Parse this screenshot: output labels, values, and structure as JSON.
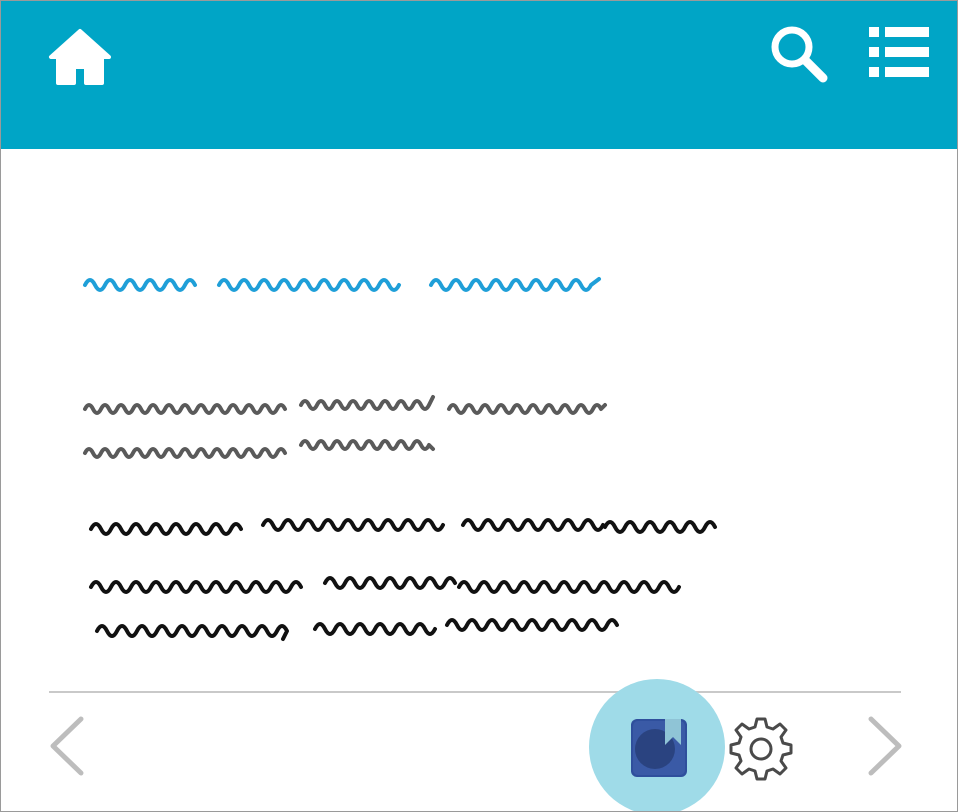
{
  "header": {
    "background_color": "#00a5c6",
    "icon_color": "#ffffff",
    "home_icon": "home-icon",
    "search_icon": "search-icon",
    "menu_icon": "list-menu-icon"
  },
  "content": {
    "title_scribble_color": "#1f9fd8",
    "subtitle_scribble_color": "#5a5a5a",
    "body_scribble_color": "#111111",
    "title_lines": 1,
    "subtitle_lines": 2,
    "body_lines": 3
  },
  "footer": {
    "prev_icon": "chevron-left-icon",
    "next_icon": "chevron-right-icon",
    "bookmark_icon": "book-bookmark-icon",
    "settings_icon": "gear-icon",
    "highlight_color": "#9fdbe8",
    "bookmark_color": "#2f4f9c",
    "arrow_color": "#bdbdbd",
    "gear_color": "#4a4a4a"
  }
}
